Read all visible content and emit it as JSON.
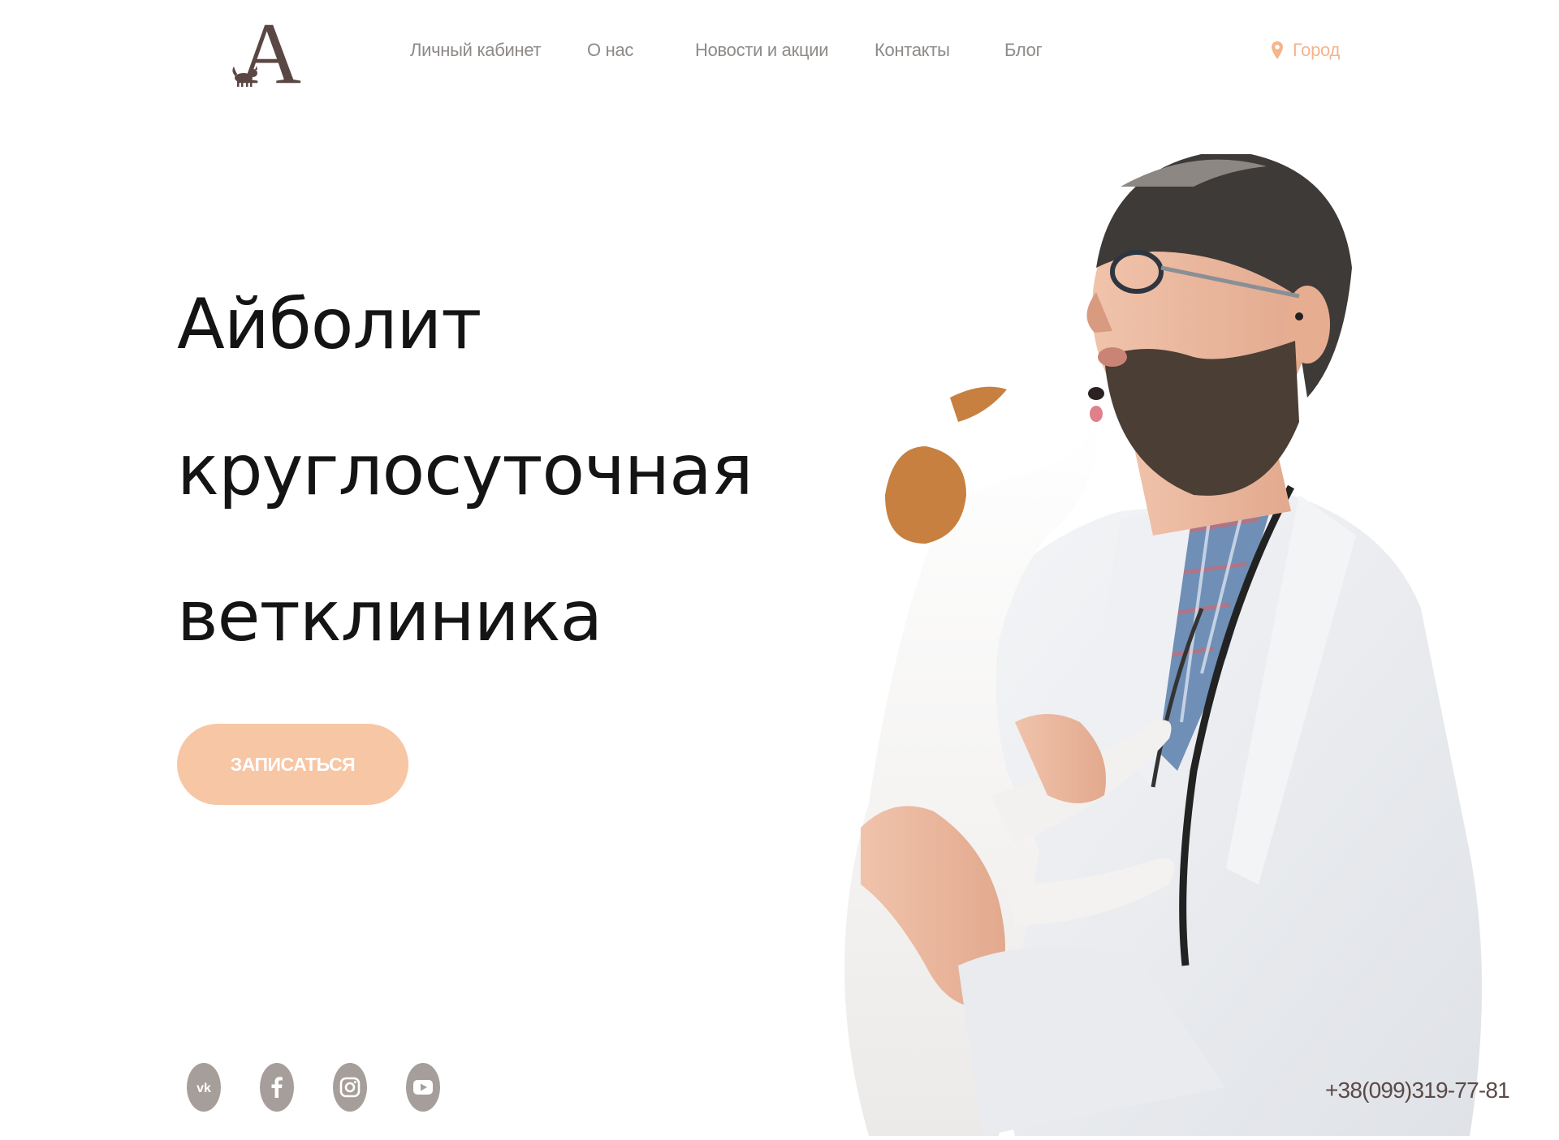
{
  "brand": {
    "logo_letter": "A"
  },
  "nav": {
    "items": [
      {
        "id": "account",
        "label": "Личный кабинет"
      },
      {
        "id": "about",
        "label": "О нас"
      },
      {
        "id": "news",
        "label": "Новости и акции"
      },
      {
        "id": "contacts",
        "label": "Контакты"
      },
      {
        "id": "blog",
        "label": "Блог"
      }
    ],
    "city": {
      "label": "Город",
      "icon": "location-pin-icon"
    }
  },
  "hero": {
    "title_lines": [
      "Айболит",
      "круглосуточная",
      "ветклиника"
    ],
    "cta_label": "ЗАПИСАТЬСЯ",
    "image_icon": "vet-with-dog-photo"
  },
  "social": {
    "items": [
      {
        "id": "vk",
        "icon": "vk-icon"
      },
      {
        "id": "facebook",
        "icon": "facebook-icon"
      },
      {
        "id": "instagram",
        "icon": "instagram-icon"
      },
      {
        "id": "youtube",
        "icon": "youtube-icon"
      }
    ]
  },
  "contact": {
    "phone": "+38(099)319-77-81"
  },
  "colors": {
    "accent": "#f7c6a5",
    "accent_text": "#f3b58d",
    "nav_text": "#8e8a87",
    "title": "#141414",
    "logo": "#5a4643",
    "social_icon_bg": "#a69e9a"
  }
}
